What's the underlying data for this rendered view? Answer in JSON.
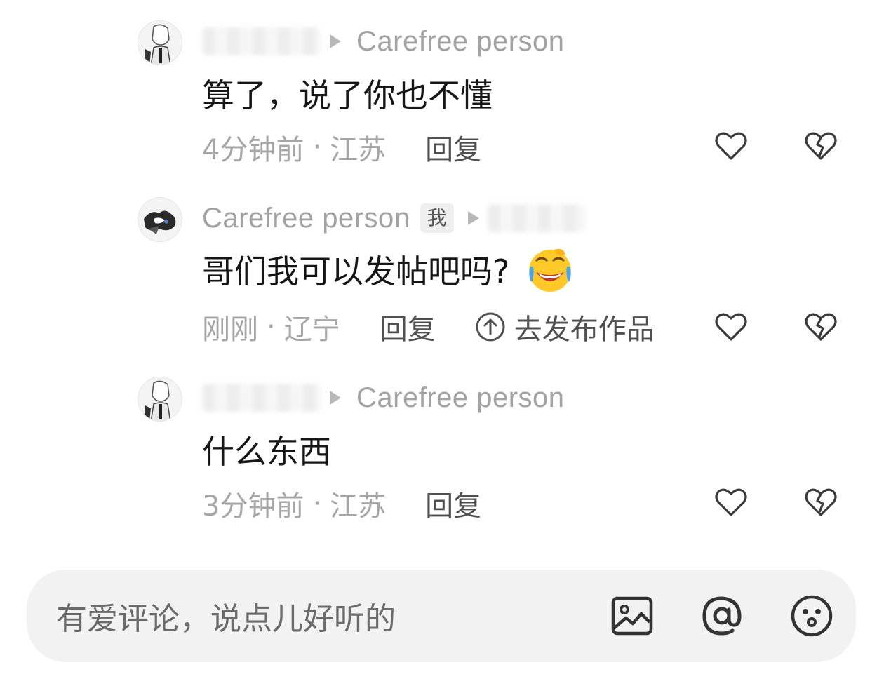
{
  "comments": [
    {
      "author_target": "Carefree person",
      "text": "算了，说了你也不懂",
      "time": "4分钟前",
      "location": "江苏",
      "reply": "回复"
    },
    {
      "author": "Carefree person",
      "me_badge": "我",
      "text": "哥们我可以发帖吧吗?",
      "time": "刚刚",
      "location": "辽宁",
      "reply": "回复",
      "publish": "去发布作品",
      "emoji": "laughing-crying-emoji"
    },
    {
      "author_target": "Carefree person",
      "text": "什么东西",
      "time": "3分钟前",
      "location": "江苏",
      "reply": "回复"
    }
  ],
  "separator": "·",
  "input_bar": {
    "placeholder": "有爱评论，说点儿好听的",
    "icons": [
      "image-icon",
      "at-icon",
      "emoji-icon"
    ]
  },
  "colors": {
    "name_gray": "#a3a3a3",
    "meta_gray": "#a6a6a6",
    "action_dark": "#505050",
    "bar_bg": "#f2f2f2",
    "icon_dark": "#333333"
  }
}
